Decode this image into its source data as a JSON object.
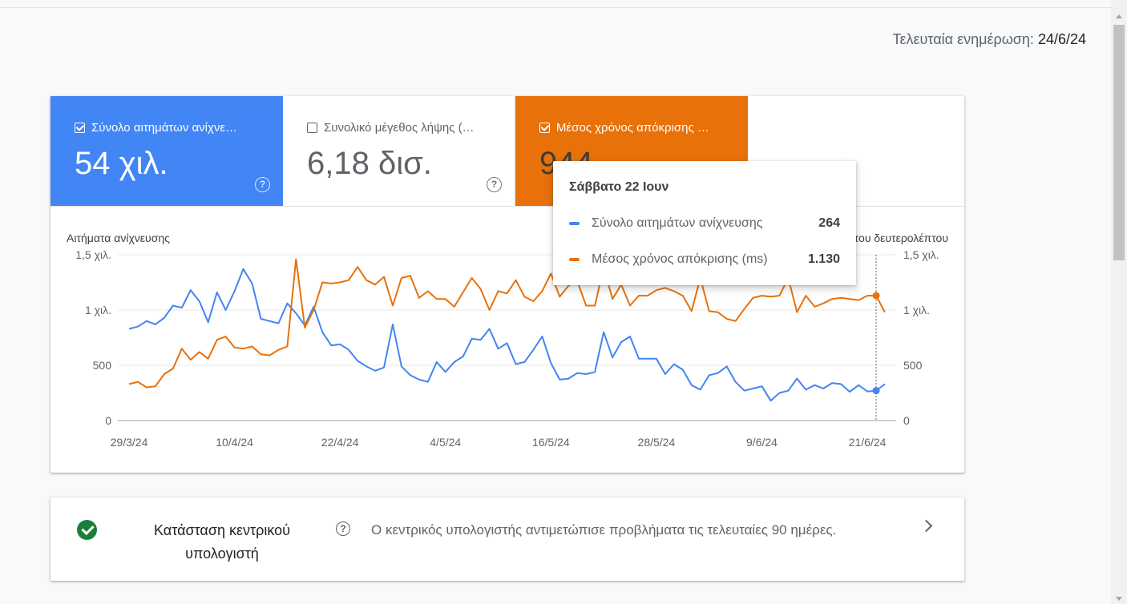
{
  "header": {
    "last_updated_label": "Τελευταία ενημέρωση:",
    "last_updated_date": "24/6/24"
  },
  "tiles": [
    {
      "label": "Σύνολο αιτημάτων ανίχνε…",
      "value": "54 χιλ.",
      "checked": true,
      "color": "#4285f4"
    },
    {
      "label": "Συνολικό μέγεθος λήψης (…",
      "value": "6,18 δισ.",
      "checked": false,
      "color": "#ffffff"
    },
    {
      "label": "Μέσος χρόνος απόκρισης …",
      "value": "944",
      "checked": true,
      "color": "#e8710a"
    }
  ],
  "tooltip": {
    "date": "Σάββατο 22 Ιουν",
    "rows": [
      {
        "label": "Σύνολο αιτημάτων ανίχνευσης",
        "value": "264",
        "color": "#4285f4"
      },
      {
        "label": "Μέσος χρόνος απόκρισης (ms)",
        "value": "1.130",
        "color": "#e8710a"
      }
    ]
  },
  "chart_data": {
    "type": "line",
    "left_axis_title": "Αιτήματα ανίχνευσης",
    "right_axis_title": "Χιλιοστά του δευτερολέπτου",
    "left_ticks": [
      "1,5 χιλ.",
      "1 χιλ.",
      "500",
      "0"
    ],
    "right_ticks": [
      "1,5 χιλ.",
      "1 χιλ.",
      "500",
      "0"
    ],
    "ylim": [
      0,
      1500
    ],
    "x_labels": [
      "29/3/24",
      "10/4/24",
      "22/4/24",
      "4/5/24",
      "16/5/24",
      "28/5/24",
      "9/6/24",
      "21/6/24"
    ],
    "x_label_index": [
      0,
      12,
      24,
      36,
      48,
      60,
      72,
      84
    ],
    "highlight_index": 85,
    "series": [
      {
        "name": "Σύνολο αιτημάτων ανίχνευσης",
        "color": "#4285f4",
        "values": [
          830,
          850,
          900,
          870,
          930,
          1040,
          1020,
          1180,
          1080,
          890,
          1160,
          1000,
          1170,
          1370,
          1240,
          920,
          900,
          880,
          1060,
          970,
          860,
          1030,
          800,
          680,
          690,
          640,
          540,
          490,
          450,
          480,
          870,
          490,
          410,
          370,
          350,
          530,
          440,
          530,
          580,
          740,
          730,
          830,
          650,
          700,
          510,
          530,
          640,
          760,
          520,
          370,
          380,
          430,
          420,
          440,
          800,
          570,
          710,
          760,
          560,
          560,
          560,
          420,
          510,
          460,
          320,
          280,
          410,
          430,
          490,
          350,
          270,
          290,
          310,
          180,
          250,
          270,
          380,
          280,
          320,
          290,
          340,
          330,
          260,
          320,
          264,
          270,
          330
        ]
      },
      {
        "name": "Μέσος χρόνος απόκρισης (ms)",
        "color": "#e8710a",
        "values": [
          330,
          350,
          300,
          310,
          420,
          470,
          650,
          550,
          620,
          560,
          730,
          760,
          660,
          650,
          670,
          600,
          590,
          640,
          670,
          1460,
          840,
          1000,
          1250,
          1240,
          1250,
          1270,
          1390,
          1270,
          1230,
          1300,
          1040,
          1290,
          1310,
          1110,
          1170,
          1100,
          1100,
          1030,
          1160,
          1290,
          1190,
          1000,
          1170,
          1150,
          1270,
          1120,
          1080,
          1170,
          1330,
          1120,
          1220,
          1260,
          1040,
          1040,
          1390,
          1100,
          1230,
          1040,
          1130,
          1130,
          1180,
          1200,
          1170,
          1130,
          990,
          1290,
          990,
          980,
          920,
          900,
          1010,
          1110,
          1130,
          1120,
          1130,
          1290,
          980,
          1130,
          1030,
          1060,
          1100,
          1110,
          1100,
          1090,
          1130,
          1130,
          980
        ]
      }
    ]
  },
  "status": {
    "title": "Κατάσταση κεντρικού υπολογιστή",
    "description": "Ο κεντρικός υπολογιστής αντιμετώπισε προβλήματα τις τελευταίες 90 ημέρες."
  }
}
